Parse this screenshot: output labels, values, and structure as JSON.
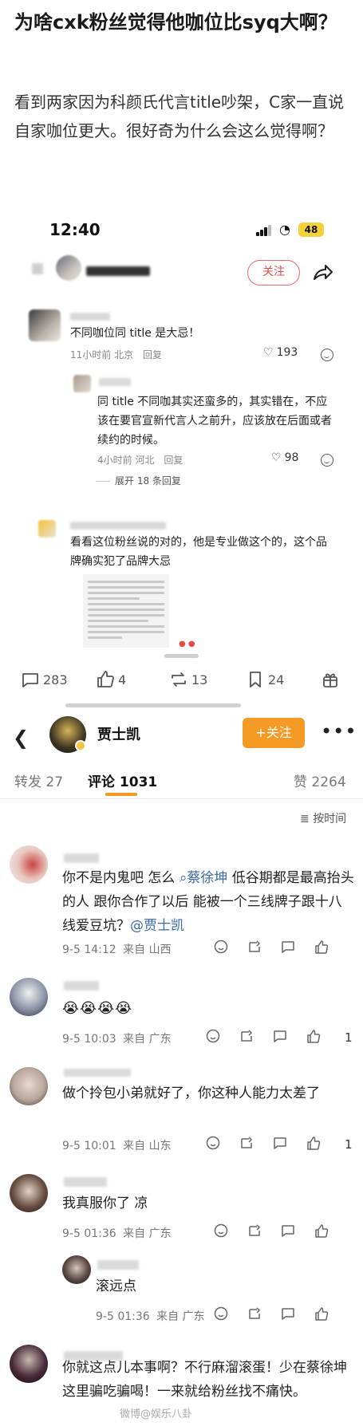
{
  "post": {
    "title": "为啥cxk粉丝觉得他咖位比syq大啊？",
    "body": "看到两家因为科颜氏代言title吵架，C家一直说自家咖位更大。很好奇为什么会这么觉得啊？"
  },
  "screenshot1": {
    "time": "12:40",
    "battery": "48",
    "follow_label": "关注",
    "comments": [
      {
        "text": "不同咖位同 title 是大忌！",
        "time": "11小时前",
        "location": "北京",
        "reply_label": "回复",
        "likes": "193"
      },
      {
        "text": "同 title 不同咖其实还蛮多的，其实错在，不应该在要官宣新代言人之前升，应该放在后面或者续约的时候。",
        "time": "4小时前",
        "location": "河北",
        "reply_label": "回复",
        "likes": "98"
      },
      {
        "text": "看看这位粉丝说的对的，他是专业做这个的，这个品牌确实犯了品牌大忌"
      }
    ],
    "expand_label": "展开 18 条回复",
    "actions": {
      "comments": "283",
      "likes": "4",
      "reposts": "13",
      "collects": "24"
    }
  },
  "weibo": {
    "profile_name": "贾士凯",
    "follow_label": "+关注",
    "tabs": {
      "repost": "转发 27",
      "comments": "评论 1031",
      "likes": "赞 2264"
    },
    "sort_label": "按时间",
    "comments": [
      {
        "text_before": "你不是内鬼吧 怎么 ",
        "mention1": "蔡徐坤",
        "text_middle": " 低谷期都是最高抬头的人 跟你合作了以后 能被一个三线牌子跟十八线爱豆坑？",
        "mention2": "@贾士凯",
        "date": "9-5 14:12",
        "source": "来自 山西"
      },
      {
        "emojis": "😭😭😭😭",
        "date": "9-5 10:03",
        "source": "来自 广东",
        "likes": "1"
      },
      {
        "text": "做个拎包小弟就好了，你这种人能力太差了",
        "date": "9-5 10:01",
        "source": "来自 山东",
        "likes": "1"
      },
      {
        "text": "我真服你了 凉",
        "date": "9-5 01:36",
        "source": "来自 广东"
      },
      {
        "text": "滚远点",
        "date": "9-5 01:36",
        "source": "来自 广东"
      },
      {
        "text": "你就这点儿本事啊？不行麻溜滚蛋！少在蔡徐坤这里骗吃骗喝！一来就给粉丝找不痛快。"
      }
    ],
    "watermark": "微博@娱乐八卦"
  }
}
